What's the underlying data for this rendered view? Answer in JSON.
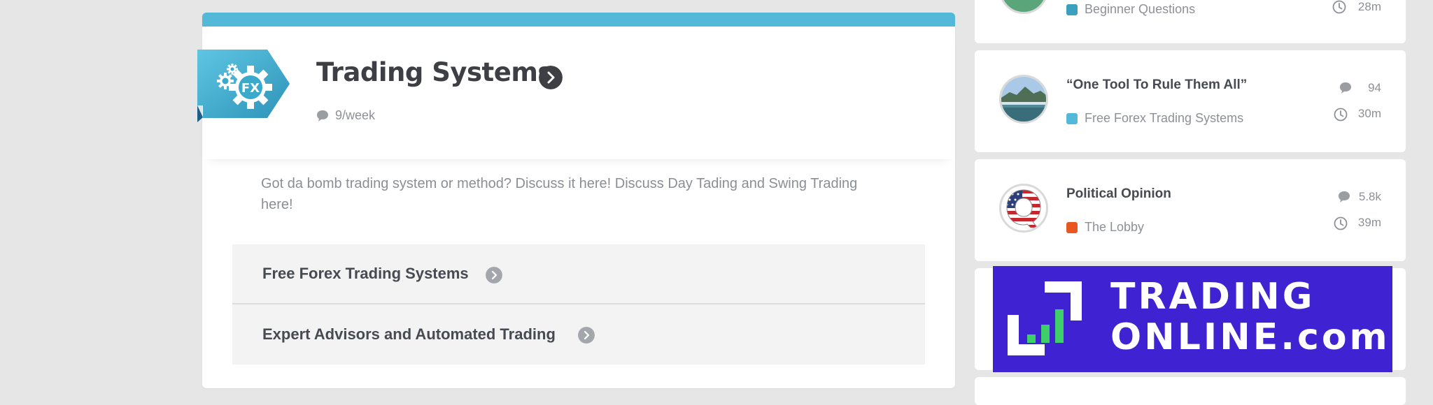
{
  "category": {
    "title": "Trading Systems",
    "badge": "FX",
    "rate": "9/week",
    "description": "Got da bomb trading system or method? Discuss it here! Discuss Day Tading and Swing Trading here!",
    "accent_color": "#54b9d9",
    "subcategories": [
      {
        "label": "Free Forex Trading Systems"
      },
      {
        "label": "Expert Advisors and Automated Trading"
      }
    ]
  },
  "topics": [
    {
      "title": "",
      "category": "Beginner Questions",
      "category_color": "#3aa0bd",
      "replies": "",
      "time": "28m",
      "avatar": "green-avatar"
    },
    {
      "title": "“One Tool To Rule Them All”",
      "category": "Free Forex Trading Systems",
      "category_color": "#54b9d9",
      "replies": "94",
      "time": "30m",
      "avatar": "landscape-avatar"
    },
    {
      "title": "Political Opinion",
      "category": "The Lobby",
      "category_color": "#e8571f",
      "replies": "5.8k",
      "time": "39m",
      "avatar": "flag-q-avatar"
    }
  ],
  "ad": {
    "line1": "TRADING",
    "line2": "ONLINE.com",
    "background": "#3f22d1",
    "accent": "#3fcf6a"
  }
}
